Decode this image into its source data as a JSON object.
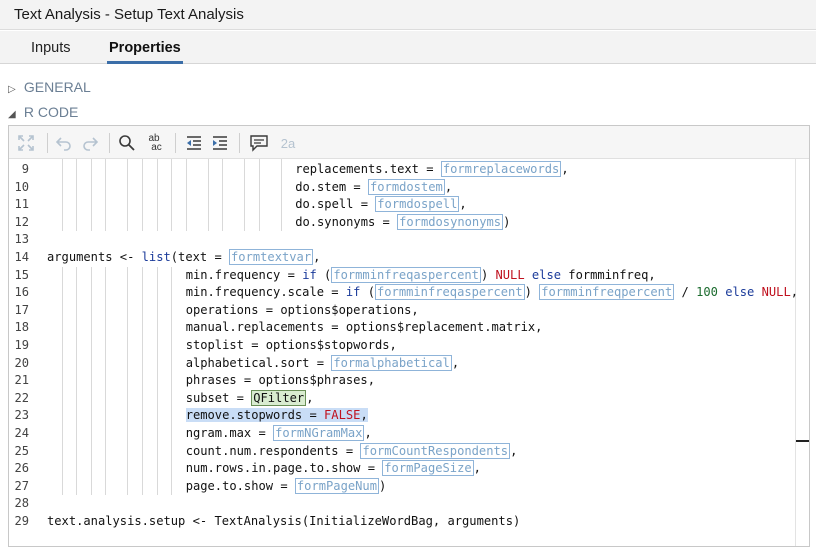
{
  "window": {
    "title": "Text Analysis - Setup Text Analysis"
  },
  "tabs": [
    {
      "label": "Inputs"
    },
    {
      "label": "Properties"
    }
  ],
  "sections": [
    {
      "label": "GENERAL",
      "state": "collapsed",
      "arrow": "▷"
    },
    {
      "label": "R CODE",
      "state": "expanded",
      "arrow": "◢"
    }
  ],
  "toolbar": {
    "icons": [
      "expand-icon",
      "undo-icon",
      "redo-icon",
      "search-icon",
      "replace-icon",
      "outdent-icon",
      "indent-icon",
      "comment-icon",
      "font-size-icon"
    ],
    "replace_label": "ab",
    "replace_sub": "ac",
    "font_label": "2a"
  },
  "code": {
    "lines": [
      {
        "n": "9",
        "indent": 34,
        "segs": [
          [
            "replacements.text = ",
            ""
          ],
          [
            "formreplacewords",
            "ph"
          ],
          [
            ",",
            ""
          ]
        ]
      },
      {
        "n": "10",
        "indent": 34,
        "segs": [
          [
            "do.stem = ",
            ""
          ],
          [
            "formdostem",
            "ph"
          ],
          [
            ",",
            ""
          ]
        ]
      },
      {
        "n": "11",
        "indent": 34,
        "segs": [
          [
            "do.spell = ",
            ""
          ],
          [
            "formdospell",
            "ph"
          ],
          [
            ",",
            ""
          ]
        ]
      },
      {
        "n": "12",
        "indent": 34,
        "segs": [
          [
            "do.synonyms = ",
            ""
          ],
          [
            "formdosynonyms",
            "ph"
          ],
          [
            ")",
            ""
          ]
        ]
      },
      {
        "n": "13",
        "indent": 0,
        "segs": []
      },
      {
        "n": "14",
        "indent": 0,
        "segs": [
          [
            "arguments <- ",
            ""
          ],
          [
            "list",
            "fn"
          ],
          [
            "(text = ",
            ""
          ],
          [
            "formtextvar",
            "ph"
          ],
          [
            ",",
            ""
          ]
        ]
      },
      {
        "n": "15",
        "indent": 19,
        "segs": [
          [
            "min.frequency = ",
            ""
          ],
          [
            "if",
            "kw"
          ],
          [
            " (",
            ""
          ],
          [
            "formminfreqaspercent",
            "ph"
          ],
          [
            ") ",
            ""
          ],
          [
            "NULL",
            "lit"
          ],
          [
            " ",
            ""
          ],
          [
            "else",
            "kw"
          ],
          [
            " formminfreq,",
            ""
          ]
        ]
      },
      {
        "n": "16",
        "indent": 19,
        "segs": [
          [
            "min.frequency.scale = ",
            ""
          ],
          [
            "if",
            "kw"
          ],
          [
            " (",
            ""
          ],
          [
            "formminfreqaspercent",
            "ph"
          ],
          [
            ") ",
            ""
          ],
          [
            "formminfreqpercent",
            "ph"
          ],
          [
            " / ",
            ""
          ],
          [
            "100",
            "num"
          ],
          [
            " ",
            ""
          ],
          [
            "else",
            "kw"
          ],
          [
            " ",
            ""
          ],
          [
            "NULL",
            "lit"
          ],
          [
            ",",
            ""
          ]
        ]
      },
      {
        "n": "17",
        "indent": 19,
        "segs": [
          [
            "operations = options$operations,",
            ""
          ]
        ]
      },
      {
        "n": "18",
        "indent": 19,
        "segs": [
          [
            "manual.replacements = options$replacement.matrix,",
            ""
          ]
        ]
      },
      {
        "n": "19",
        "indent": 19,
        "segs": [
          [
            "stoplist = options$stopwords,",
            ""
          ]
        ]
      },
      {
        "n": "20",
        "indent": 19,
        "segs": [
          [
            "alphabetical.sort = ",
            ""
          ],
          [
            "formalphabetical",
            "ph"
          ],
          [
            ",",
            ""
          ]
        ]
      },
      {
        "n": "21",
        "indent": 19,
        "segs": [
          [
            "phrases = options$phrases,",
            ""
          ]
        ]
      },
      {
        "n": "22",
        "indent": 19,
        "segs": [
          [
            "subset = ",
            ""
          ],
          [
            "QFilter",
            "qf"
          ],
          [
            ",",
            ""
          ]
        ]
      },
      {
        "n": "23",
        "indent": 19,
        "highlight": true,
        "segs": [
          [
            "remove.stopwords = ",
            ""
          ],
          [
            "FALSE",
            "lit"
          ],
          [
            ",",
            ""
          ]
        ]
      },
      {
        "n": "24",
        "indent": 19,
        "segs": [
          [
            "ngram.max = ",
            ""
          ],
          [
            "formNGramMax",
            "ph"
          ],
          [
            ",",
            ""
          ]
        ]
      },
      {
        "n": "25",
        "indent": 19,
        "segs": [
          [
            "count.num.respondents = ",
            ""
          ],
          [
            "formCountRespondents",
            "ph"
          ],
          [
            ",",
            ""
          ]
        ]
      },
      {
        "n": "26",
        "indent": 19,
        "segs": [
          [
            "num.rows.in.page.to.show = ",
            ""
          ],
          [
            "formPageSize",
            "ph"
          ],
          [
            ",",
            ""
          ]
        ]
      },
      {
        "n": "27",
        "indent": 19,
        "segs": [
          [
            "page.to.show = ",
            ""
          ],
          [
            "formPageNum",
            "ph"
          ],
          [
            ")",
            ""
          ]
        ]
      },
      {
        "n": "28",
        "indent": 0,
        "segs": []
      },
      {
        "n": "29",
        "indent": 0,
        "segs": [
          [
            "text.analysis.setup <- TextAnalysis(InitializeWordBag, arguments)",
            ""
          ]
        ]
      }
    ]
  }
}
